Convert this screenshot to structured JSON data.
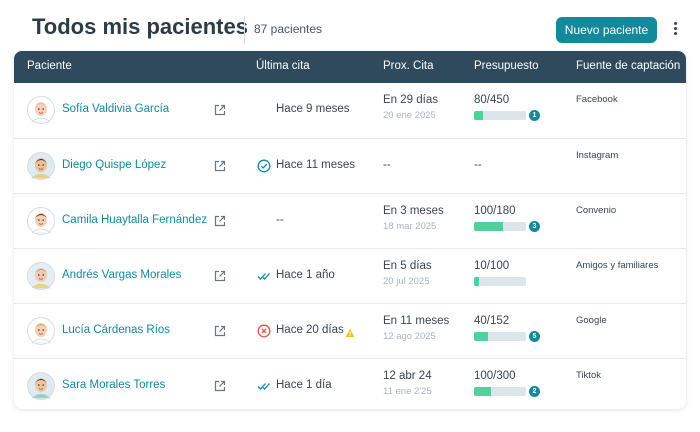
{
  "header": {
    "title": "Todos mis pacientes",
    "count_label": "87 pacientes",
    "new_button_label": "Nuevo paciente"
  },
  "table": {
    "columns": [
      "Paciente",
      "Última cita",
      "Prox. Cita",
      "Presupuesto",
      "Fuente de captación"
    ],
    "rows": [
      {
        "name": "Sofía Valdivia García",
        "last_visit": "Hace 9 meses",
        "last_icon": "none",
        "next_main": "En 29 días",
        "next_sub": "20 ene 2025",
        "budget": "80/450",
        "budget_fraction": 0.18,
        "badge": "1",
        "source": "Facebook"
      },
      {
        "name": "Diego Quispe López",
        "last_visit": "Hace 11 meses",
        "last_icon": "check-circle-icon",
        "next_main": "--",
        "next_sub": "",
        "budget": "--",
        "budget_fraction": null,
        "badge": "",
        "source": "Instagram"
      },
      {
        "name": "Camila Huaytalla Fernández",
        "last_visit": "--",
        "last_icon": "none",
        "next_main": "En 3 meses",
        "next_sub": "18 mar 2025",
        "budget": "100/180",
        "budget_fraction": 0.56,
        "badge": "3",
        "source": "Convenio"
      },
      {
        "name": "Andrés Vargas Morales",
        "last_visit": "Hace 1 año",
        "last_icon": "double-check-icon",
        "next_main": "En 5 días",
        "next_sub": "20 jul 2025",
        "budget": "10/100",
        "budget_fraction": 0.1,
        "badge": "",
        "source": "Amigos y familiares"
      },
      {
        "name": "Lucía Cárdenas Ríos",
        "last_visit": "Hace 20 días",
        "last_icon": "x-circle-icon",
        "warning": true,
        "next_main": "En 11 meses",
        "next_sub": "12 ago 2025",
        "budget": "40/152",
        "budget_fraction": 0.26,
        "badge": "5",
        "source": "Google"
      },
      {
        "name": "Sara Morales Torres",
        "last_visit": "Hace 1 día",
        "last_icon": "double-check-icon",
        "next_main": "12 abr 24",
        "next_sub": "11 ene 2'25",
        "budget": "100/300",
        "budget_fraction": 0.33,
        "badge": "2",
        "source": "Tiktok"
      }
    ]
  },
  "colors": {
    "brand": "#14899c",
    "header_bg": "#2e4a5c",
    "bar_fill": "#4fd09c",
    "bar_track": "#dce6ea",
    "check_green": "#14899c",
    "error_red": "#d9534f",
    "warning_yellow": "#f0c419"
  }
}
